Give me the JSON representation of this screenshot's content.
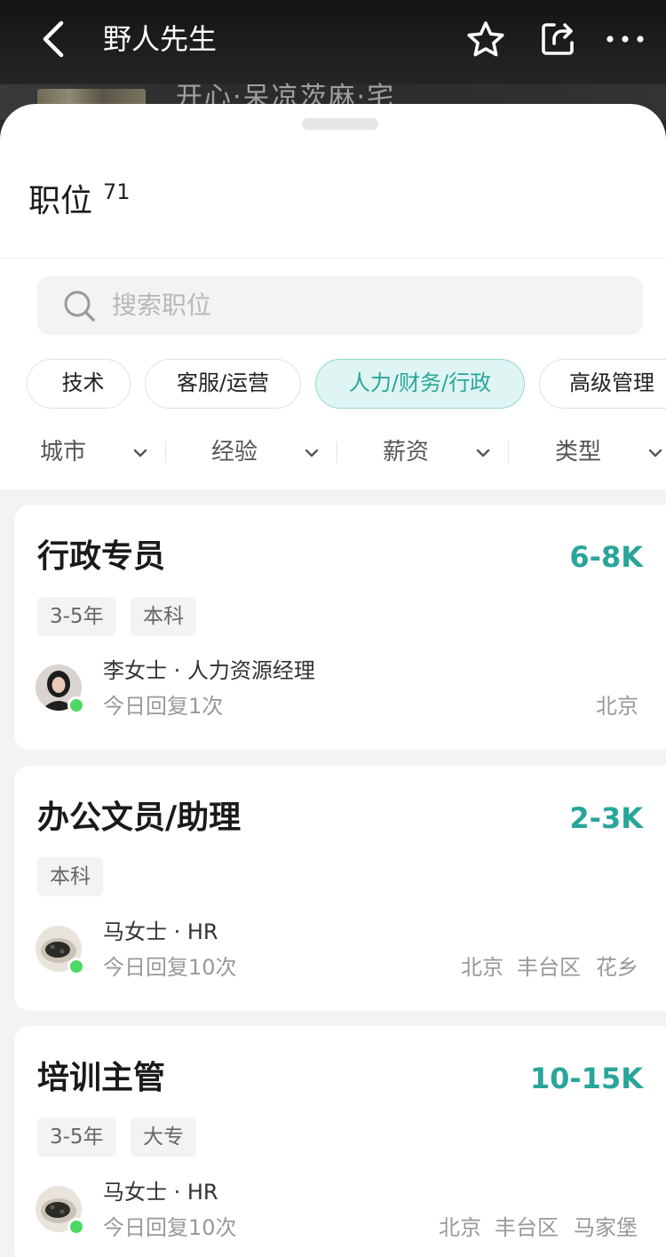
{
  "header": {
    "title": "野人先生",
    "background_text": "开心·呆凉茨麻·宅"
  },
  "sheet": {
    "section_title": "职位",
    "section_count": "71",
    "search": {
      "placeholder": "搜索职位"
    },
    "categories": [
      {
        "label": "技术",
        "active": false
      },
      {
        "label": "客服/运营",
        "active": false
      },
      {
        "label": "人力/财务/行政",
        "active": true
      },
      {
        "label": "高级管理",
        "active": false
      }
    ],
    "filters": [
      "城市",
      "经验",
      "薪资",
      "类型"
    ]
  },
  "jobs": [
    {
      "title": "行政专员",
      "salary": "6-8K",
      "tags": [
        "3-5年",
        "本科"
      ],
      "recruiter": "李女士 · 人力资源经理",
      "reply": "今日回复1次",
      "location": [
        "北京"
      ]
    },
    {
      "title": "办公文员/助理",
      "salary": "2-3K",
      "tags": [
        "本科"
      ],
      "recruiter": "马女士 · HR",
      "reply": "今日回复10次",
      "location": [
        "北京",
        "丰台区",
        "花乡"
      ]
    },
    {
      "title": "培训主管",
      "salary": "10-15K",
      "tags": [
        "3-5年",
        "大专"
      ],
      "recruiter": "马女士 · HR",
      "reply": "今日回复10次",
      "location": [
        "北京",
        "丰台区",
        "马家堡"
      ]
    }
  ],
  "colors": {
    "accent": "#29a59a",
    "active_chip_bg": "#dff5f3",
    "online": "#4cd964"
  }
}
